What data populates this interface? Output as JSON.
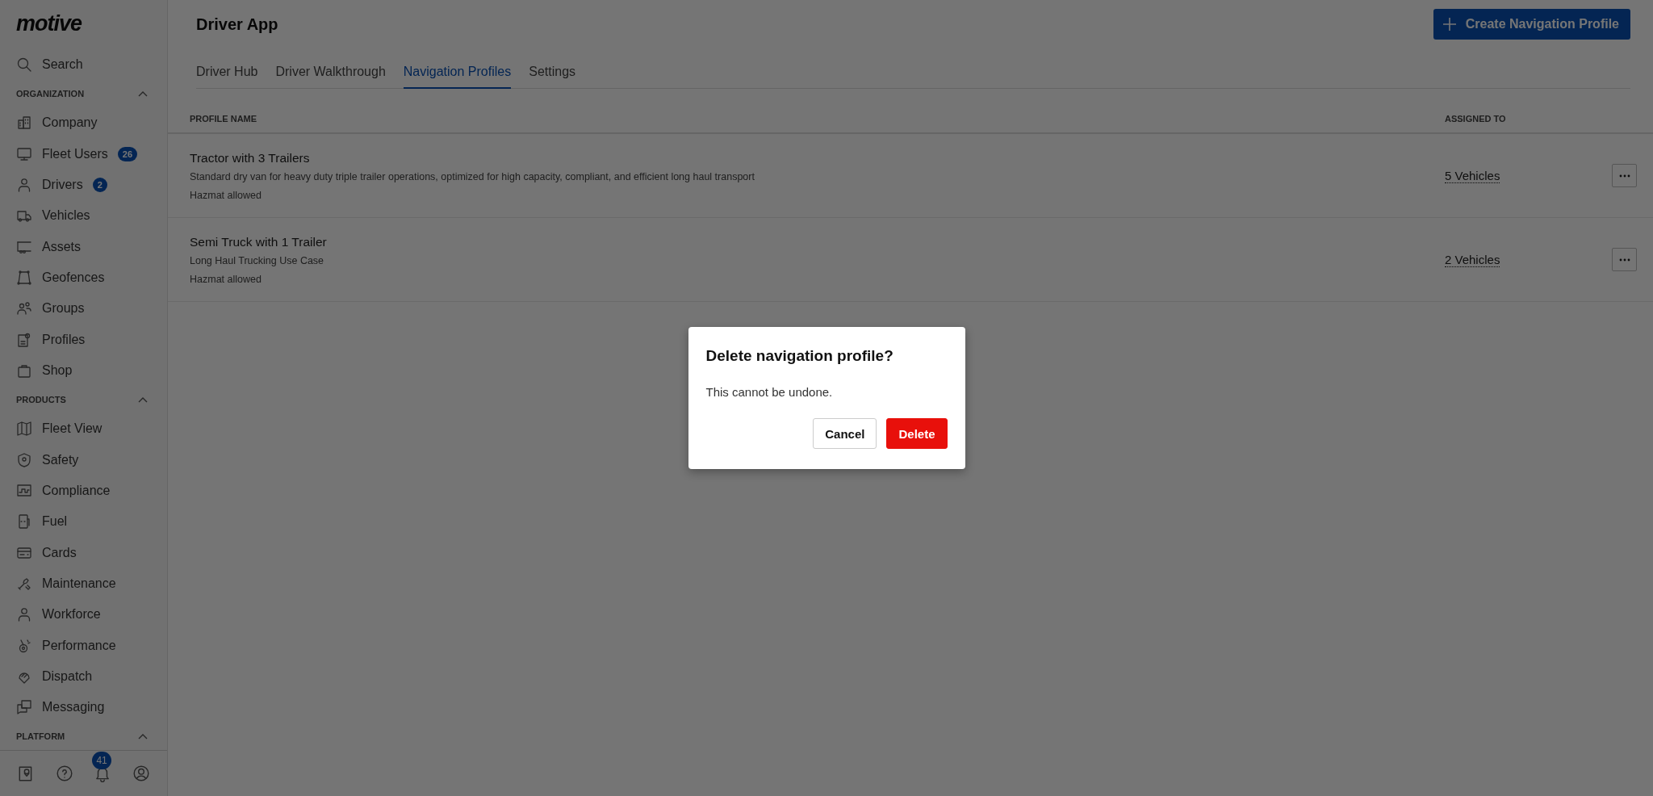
{
  "sidebar": {
    "logo": "motive",
    "search": "Search",
    "sections": [
      {
        "title": "ORGANIZATION",
        "expanded": true,
        "items": [
          {
            "label": "Company"
          },
          {
            "label": "Fleet Users",
            "badge": "26"
          },
          {
            "label": "Drivers",
            "badge": "2"
          },
          {
            "label": "Vehicles"
          },
          {
            "label": "Assets"
          },
          {
            "label": "Geofences"
          },
          {
            "label": "Groups"
          },
          {
            "label": "Profiles"
          },
          {
            "label": "Shop"
          }
        ]
      },
      {
        "title": "PRODUCTS",
        "expanded": true,
        "items": [
          {
            "label": "Fleet View"
          },
          {
            "label": "Safety"
          },
          {
            "label": "Compliance"
          },
          {
            "label": "Fuel"
          },
          {
            "label": "Cards"
          },
          {
            "label": "Maintenance"
          },
          {
            "label": "Workforce"
          },
          {
            "label": "Performance"
          },
          {
            "label": "Dispatch"
          },
          {
            "label": "Messaging"
          }
        ]
      },
      {
        "title": "PLATFORM",
        "expanded": true
      }
    ],
    "notification_badge": "41"
  },
  "header": {
    "title": "Driver App",
    "create_button": "Create Navigation Profile"
  },
  "tabs": [
    {
      "label": "Driver Hub",
      "selected": false
    },
    {
      "label": "Driver Walkthrough",
      "selected": false
    },
    {
      "label": "Navigation Profiles",
      "selected": true
    },
    {
      "label": "Settings",
      "selected": false
    }
  ],
  "table": {
    "columns": [
      "PROFILE NAME",
      "ASSIGNED TO"
    ],
    "rows": [
      {
        "name": "Tractor with 3 Trailers",
        "description": "Standard dry van for heavy duty triple trailer operations, optimized for high capacity, compliant, and efficient long haul transport",
        "note": "Hazmat allowed",
        "assigned": "5 Vehicles"
      },
      {
        "name": "Semi Truck with 1 Trailer",
        "description": "Long Haul Trucking Use Case",
        "note": "Hazmat allowed",
        "assigned": "2 Vehicles"
      }
    ]
  },
  "dialog": {
    "title": "Delete navigation profile?",
    "message": "This cannot be undone.",
    "buttons": [
      "Cancel",
      "Delete"
    ]
  }
}
